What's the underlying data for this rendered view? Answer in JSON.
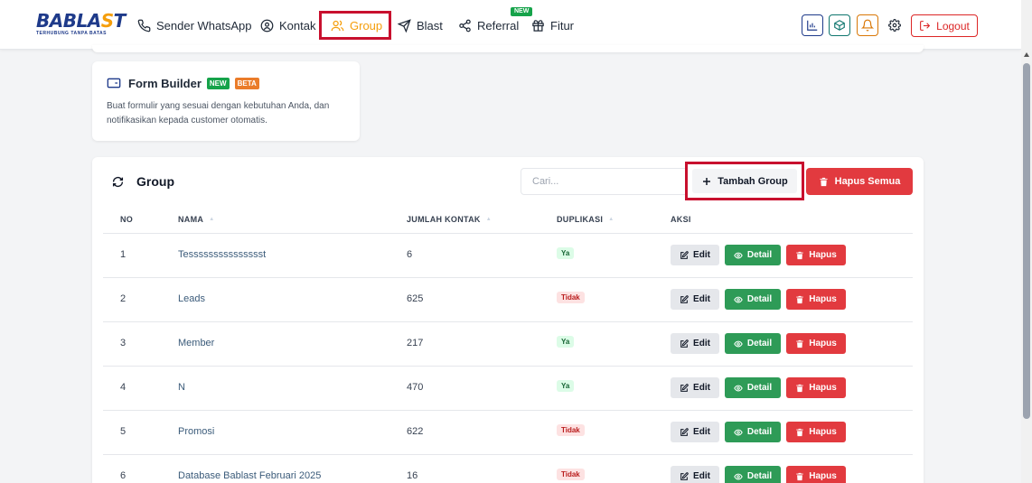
{
  "brand": {
    "name_main": "BABLA",
    "name_accent": "S",
    "name_end": "T",
    "tagline": "TERHUBUNG TANPA BATAS"
  },
  "nav": [
    {
      "label": "Sender WhatsApp",
      "icon": "phone-icon"
    },
    {
      "label": "Kontak",
      "icon": "user-circle-icon"
    },
    {
      "label": "Group",
      "icon": "users-icon",
      "active": true
    },
    {
      "label": "Blast",
      "icon": "send-icon"
    },
    {
      "label": "Referral",
      "icon": "share-icon",
      "badge": "NEW"
    },
    {
      "label": "Fitur",
      "icon": "gift-icon"
    }
  ],
  "header_actions": {
    "logout_label": "Logout"
  },
  "form_builder": {
    "title": "Form Builder",
    "badge_new": "NEW",
    "badge_beta": "BETA",
    "description": "Buat formulir yang sesuai dengan kebutuhan Anda, dan notifikasikan kepada customer otomatis."
  },
  "group": {
    "title": "Group",
    "search_placeholder": "Cari...",
    "add_label": "Tambah Group",
    "delete_all_label": "Hapus Semua",
    "columns": {
      "no": "NO",
      "nama": "NAMA",
      "jumlah": "JUMLAH KONTAK",
      "duplikasi": "DUPLIKASI",
      "aksi": "AKSI"
    },
    "actions": {
      "edit": "Edit",
      "detail": "Detail",
      "hapus": "Hapus"
    },
    "rows": [
      {
        "no": "1",
        "nama": "Tessssssssssssssst",
        "jumlah": "6",
        "duplikasi": "Ya"
      },
      {
        "no": "2",
        "nama": "Leads",
        "jumlah": "625",
        "duplikasi": "Tidak"
      },
      {
        "no": "3",
        "nama": "Member",
        "jumlah": "217",
        "duplikasi": "Ya"
      },
      {
        "no": "4",
        "nama": "N",
        "jumlah": "470",
        "duplikasi": "Ya"
      },
      {
        "no": "5",
        "nama": "Promosi",
        "jumlah": "622",
        "duplikasi": "Tidak"
      },
      {
        "no": "6",
        "nama": "Database Bablast Februari 2025",
        "jumlah": "16",
        "duplikasi": "Tidak"
      }
    ]
  },
  "colors": {
    "accent": "#f59e0b",
    "primary": "#1e3a8a",
    "danger": "#e23a3f",
    "success": "#2e9b57",
    "highlight": "#c8102e"
  }
}
